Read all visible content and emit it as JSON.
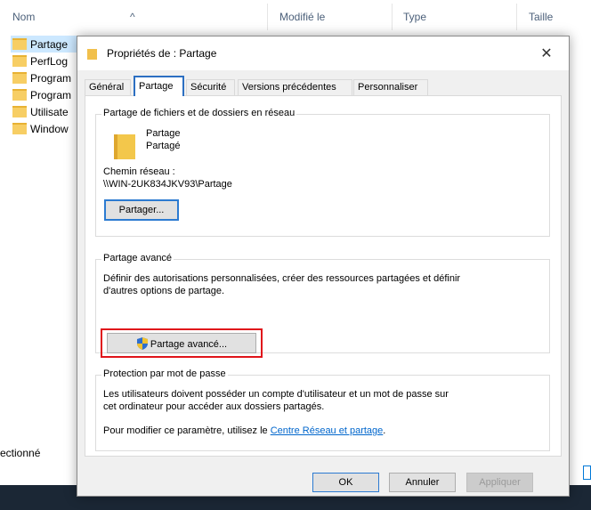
{
  "explorer": {
    "columns": {
      "name": "Nom",
      "modified": "Modifié le",
      "type": "Type",
      "size": "Taille"
    },
    "files": [
      {
        "name": "Partage",
        "selected": true
      },
      {
        "name": "PerfLog",
        "selected": false
      },
      {
        "name": "Program",
        "selected": false
      },
      {
        "name": "Program",
        "selected": false
      },
      {
        "name": "Utilisate",
        "selected": false
      },
      {
        "name": "Window",
        "selected": false
      }
    ],
    "status_fragment": "ectionné"
  },
  "dialog": {
    "title": "Propriétés de : Partage",
    "close_glyph": "✕",
    "tabs": [
      {
        "label": "Général",
        "active": false
      },
      {
        "label": "Partage",
        "active": true
      },
      {
        "label": "Sécurité",
        "active": false
      },
      {
        "label": "Versions précédentes",
        "active": false
      },
      {
        "label": "Personnaliser",
        "active": false
      }
    ],
    "network_share": {
      "group_title": "Partage de fichiers et de dossiers en réseau",
      "folder_name": "Partage",
      "folder_state": "Partagé",
      "path_label": "Chemin réseau :",
      "path_value": "\\\\WIN-2UK834JKV93\\Partage",
      "share_button": "Partager..."
    },
    "advanced_share": {
      "group_title": "Partage avancé",
      "description_line1": "Définir des autorisations personnalisées, créer des ressources partagées et définir",
      "description_line2": "d'autres options de partage.",
      "button": "Partage avancé..."
    },
    "password_protection": {
      "group_title": "Protection par mot de passe",
      "line1": "Les utilisateurs doivent posséder un compte d'utilisateur et un mot de passe sur",
      "line2": "cet ordinateur pour accéder aux dossiers partagés.",
      "change_prefix": "Pour modifier ce paramètre, utilisez le ",
      "link_text": "Centre Réseau et partage",
      "change_suffix": "."
    },
    "buttons": {
      "ok": "OK",
      "cancel": "Annuler",
      "apply": "Appliquer"
    }
  },
  "icons": {
    "folder": "folder-icon",
    "shield": "uac-shield-icon",
    "close": "close-icon"
  },
  "colors": {
    "highlight": "#e0151b",
    "focus": "#2c7bd1",
    "link": "#0066cc",
    "selection": "#cce8ff",
    "taskbar": "#1b2735"
  }
}
